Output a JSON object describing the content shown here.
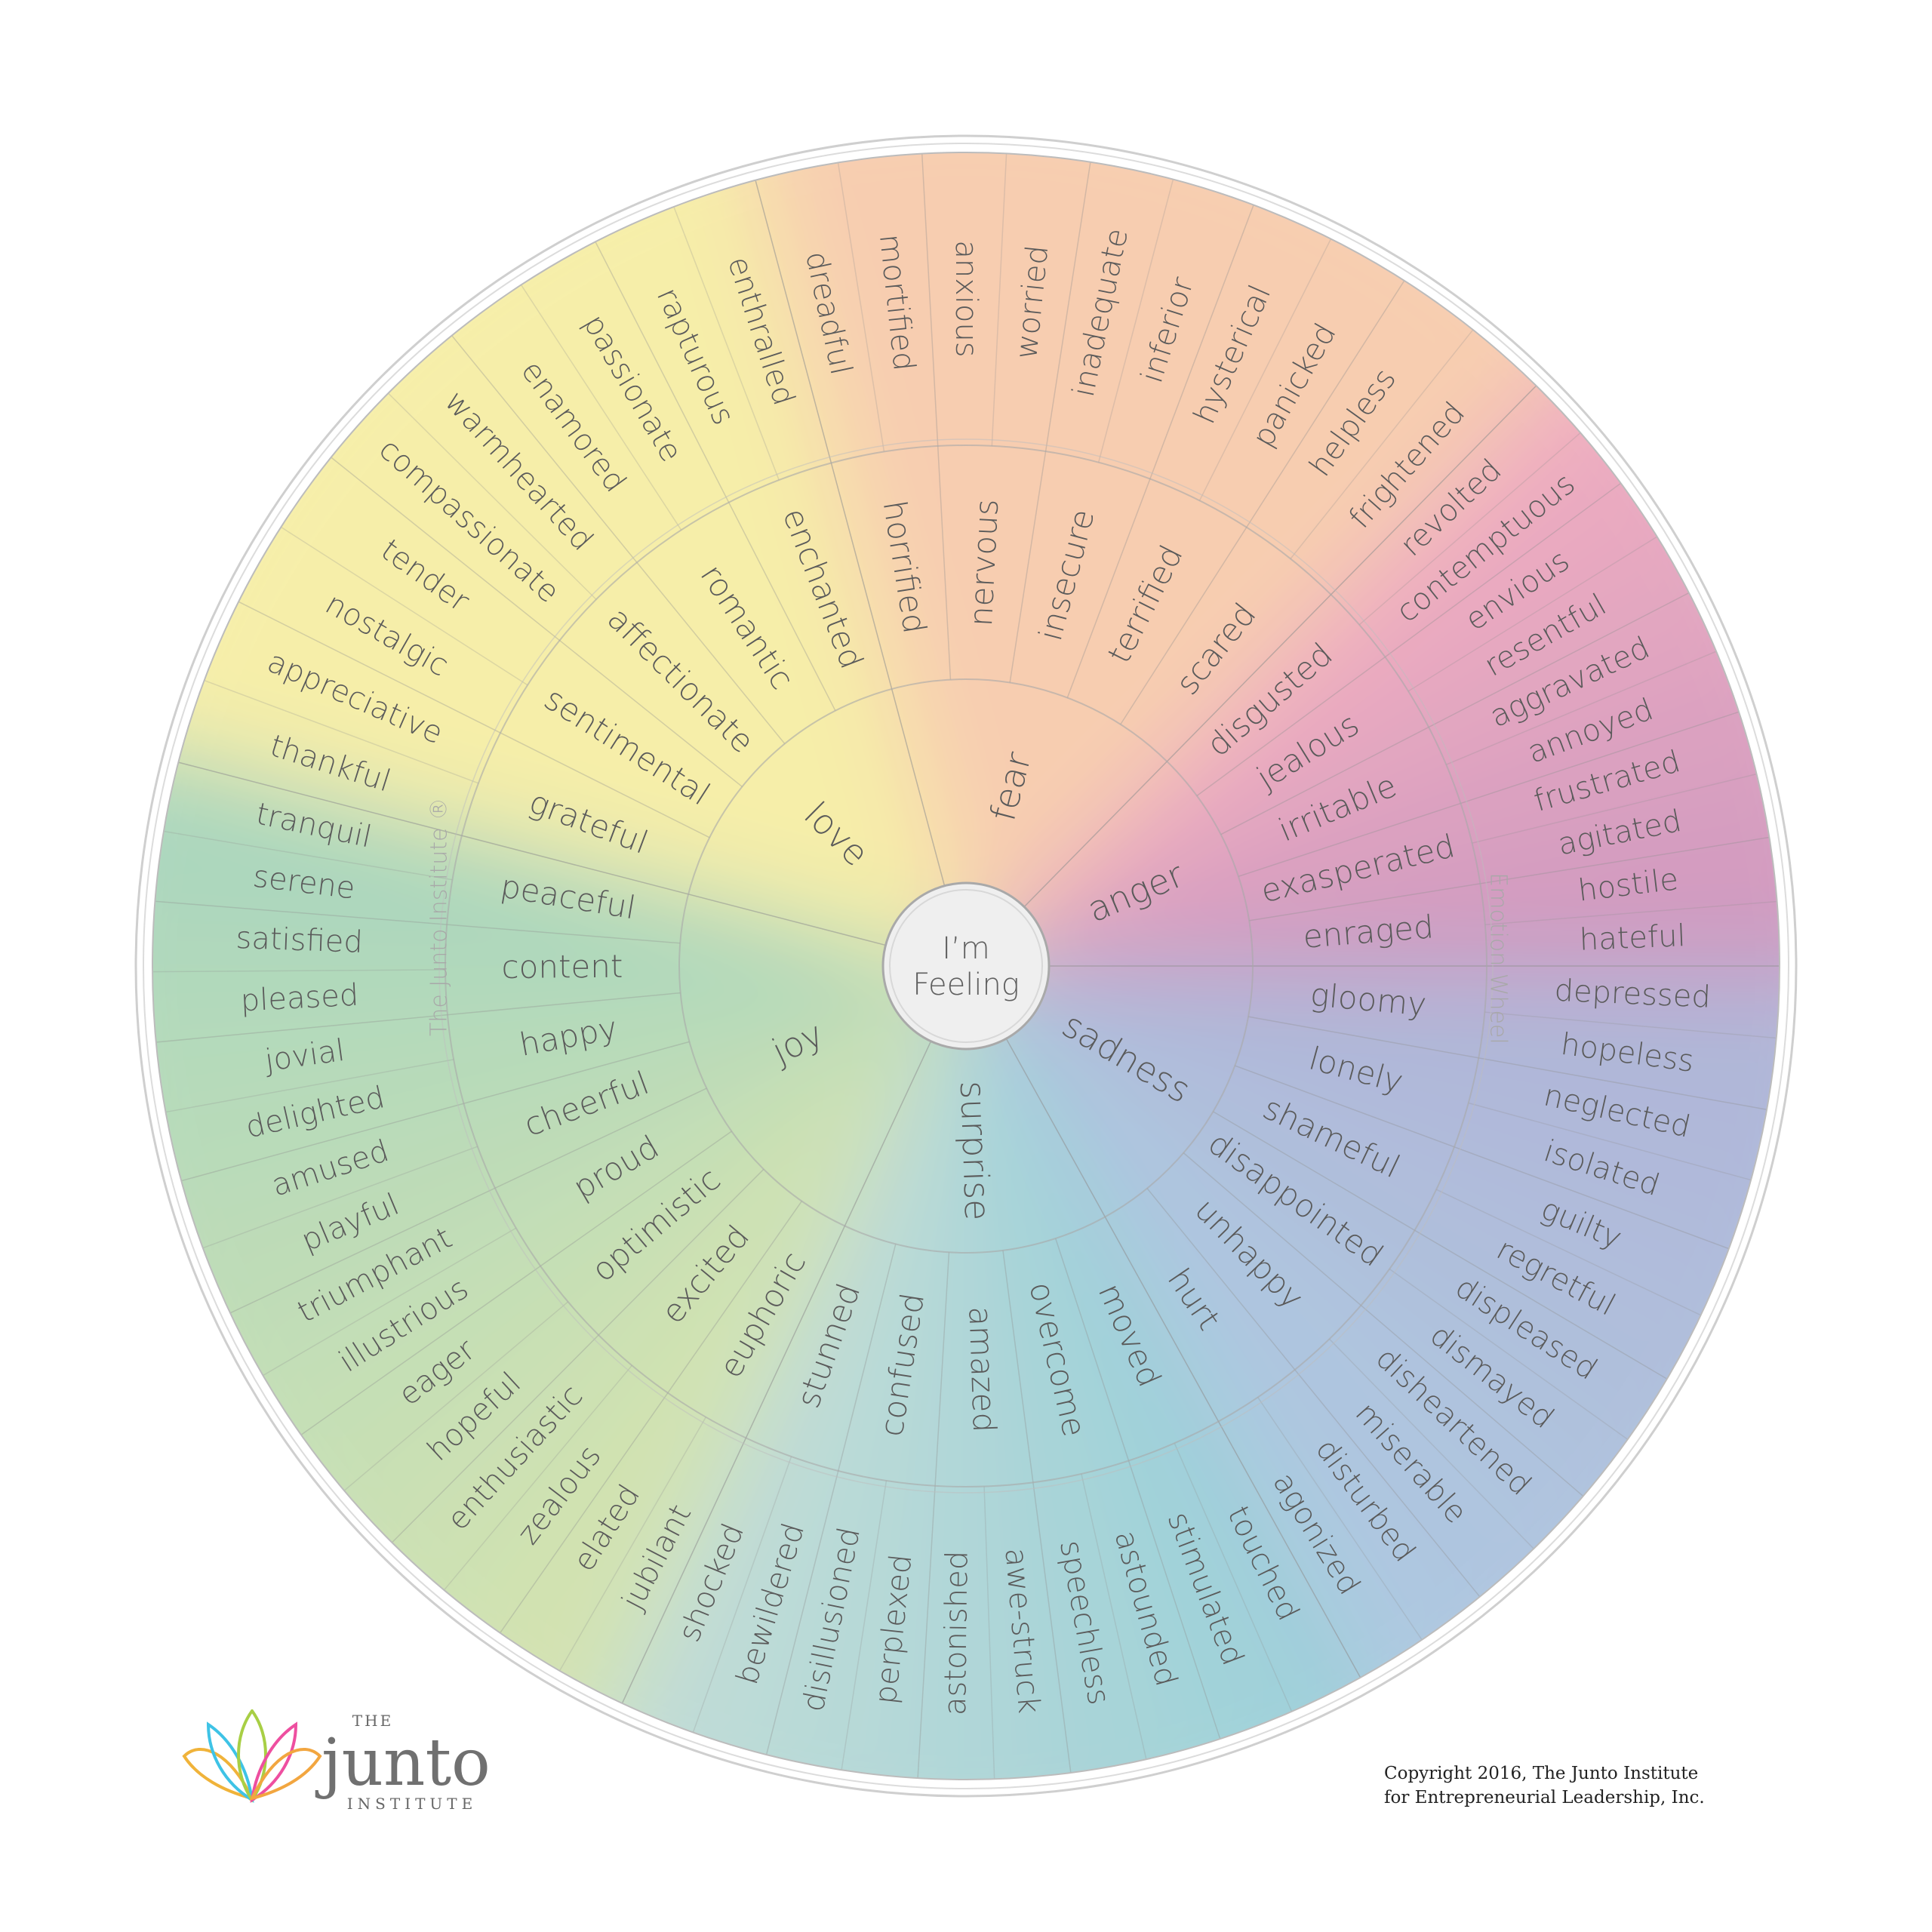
{
  "center": {
    "line1": "I’m",
    "line2": "Feeling"
  },
  "ring_labels": {
    "left": "The Junto Institute ®",
    "right": "Emotion Wheel"
  },
  "colors": {
    "love": "#f5ec9e",
    "fear": "#f6c7a6",
    "anger": "#eea3b8",
    "anger_end": "#c98cb8",
    "sadness": "#a6abd2",
    "sadness_end": "#a3c2dd",
    "surprise": "#8fcad4",
    "surprise_end": "#b9d8d2",
    "joy": "#cfe0a6",
    "joy_end": "#9fd1b5",
    "text": "#5a5a5a",
    "ring": "#cfcfcf"
  },
  "emotions": [
    {
      "core": "love",
      "middle": [
        {
          "label": "grateful",
          "outer": [
            "thankful",
            "appreciative"
          ]
        },
        {
          "label": "sentimental",
          "outer": [
            "nostalgic",
            "tender"
          ]
        },
        {
          "label": "affectionate",
          "outer": [
            "compassionate",
            "warmhearted"
          ]
        },
        {
          "label": "romantic",
          "outer": [
            "enamored",
            "passionate"
          ]
        },
        {
          "label": "enchanted",
          "outer": [
            "rapturous",
            "enthralled"
          ]
        }
      ]
    },
    {
      "core": "joy",
      "middle": [
        {
          "label": "euphoric",
          "outer": [
            "jubilant",
            "elated"
          ]
        },
        {
          "label": "excited",
          "outer": [
            "zealous",
            "enthusiastic"
          ]
        },
        {
          "label": "optimistic",
          "outer": [
            "hopeful",
            "eager"
          ]
        },
        {
          "label": "proud",
          "outer": [
            "illustrious",
            "triumphant"
          ]
        },
        {
          "label": "cheerful",
          "outer": [
            "playful",
            "amused"
          ]
        },
        {
          "label": "happy",
          "outer": [
            "delighted",
            "jovial"
          ]
        },
        {
          "label": "content",
          "outer": [
            "pleased",
            "satisfied"
          ]
        },
        {
          "label": "peaceful",
          "outer": [
            "serene",
            "tranquil"
          ]
        }
      ]
    },
    {
      "core": "surprise",
      "middle": [
        {
          "label": "moved",
          "outer": [
            "touched",
            "stimulated"
          ]
        },
        {
          "label": "overcome",
          "outer": [
            "astounded",
            "speechless"
          ]
        },
        {
          "label": "amazed",
          "outer": [
            "awe-struck",
            "astonished"
          ]
        },
        {
          "label": "confused",
          "outer": [
            "perplexed",
            "disillusioned"
          ]
        },
        {
          "label": "stunned",
          "outer": [
            "bewildered",
            "shocked"
          ]
        }
      ]
    },
    {
      "core": "sadness",
      "middle": [
        {
          "label": "gloomy",
          "outer": [
            "depressed",
            "hopeless"
          ]
        },
        {
          "label": "lonely",
          "outer": [
            "neglected",
            "isolated"
          ]
        },
        {
          "label": "shameful",
          "outer": [
            "guilty",
            "regretful"
          ]
        },
        {
          "label": "disappointed",
          "outer": [
            "displeased",
            "dismayed"
          ]
        },
        {
          "label": "unhappy",
          "outer": [
            "disheartened",
            "miserable"
          ]
        },
        {
          "label": "hurt",
          "outer": [
            "disturbed",
            "agonized"
          ]
        }
      ]
    },
    {
      "core": "anger",
      "middle": [
        {
          "label": "disgusted",
          "outer": [
            "revolted",
            "contemptuous"
          ]
        },
        {
          "label": "jealous",
          "outer": [
            "envious",
            "resentful"
          ]
        },
        {
          "label": "irritable",
          "outer": [
            "aggravated",
            "annoyed"
          ]
        },
        {
          "label": "exasperated",
          "outer": [
            "frustrated",
            "agitated"
          ]
        },
        {
          "label": "enraged",
          "outer": [
            "hostile",
            "hateful"
          ]
        }
      ]
    },
    {
      "core": "fear",
      "middle": [
        {
          "label": "horrified",
          "outer": [
            "dreadful",
            "mortified"
          ]
        },
        {
          "label": "nervous",
          "outer": [
            "anxious",
            "worried"
          ]
        },
        {
          "label": "insecure",
          "outer": [
            "inadequate",
            "inferior"
          ]
        },
        {
          "label": "terrified",
          "outer": [
            "hysterical",
            "panicked"
          ]
        },
        {
          "label": "scared",
          "outer": [
            "helpless",
            "frightened"
          ]
        }
      ]
    }
  ],
  "logo": {
    "the": "THE",
    "name": "junto",
    "institute": "INSTITUTE",
    "petal_colors": [
      "#f0b33a",
      "#3ec3e6",
      "#a8cf45",
      "#ee4fa0",
      "#f2a640"
    ]
  },
  "copyright": {
    "line1": "Copyright 2016, The Junto Institute",
    "line2": "for Entrepreneurial Leadership, Inc."
  }
}
